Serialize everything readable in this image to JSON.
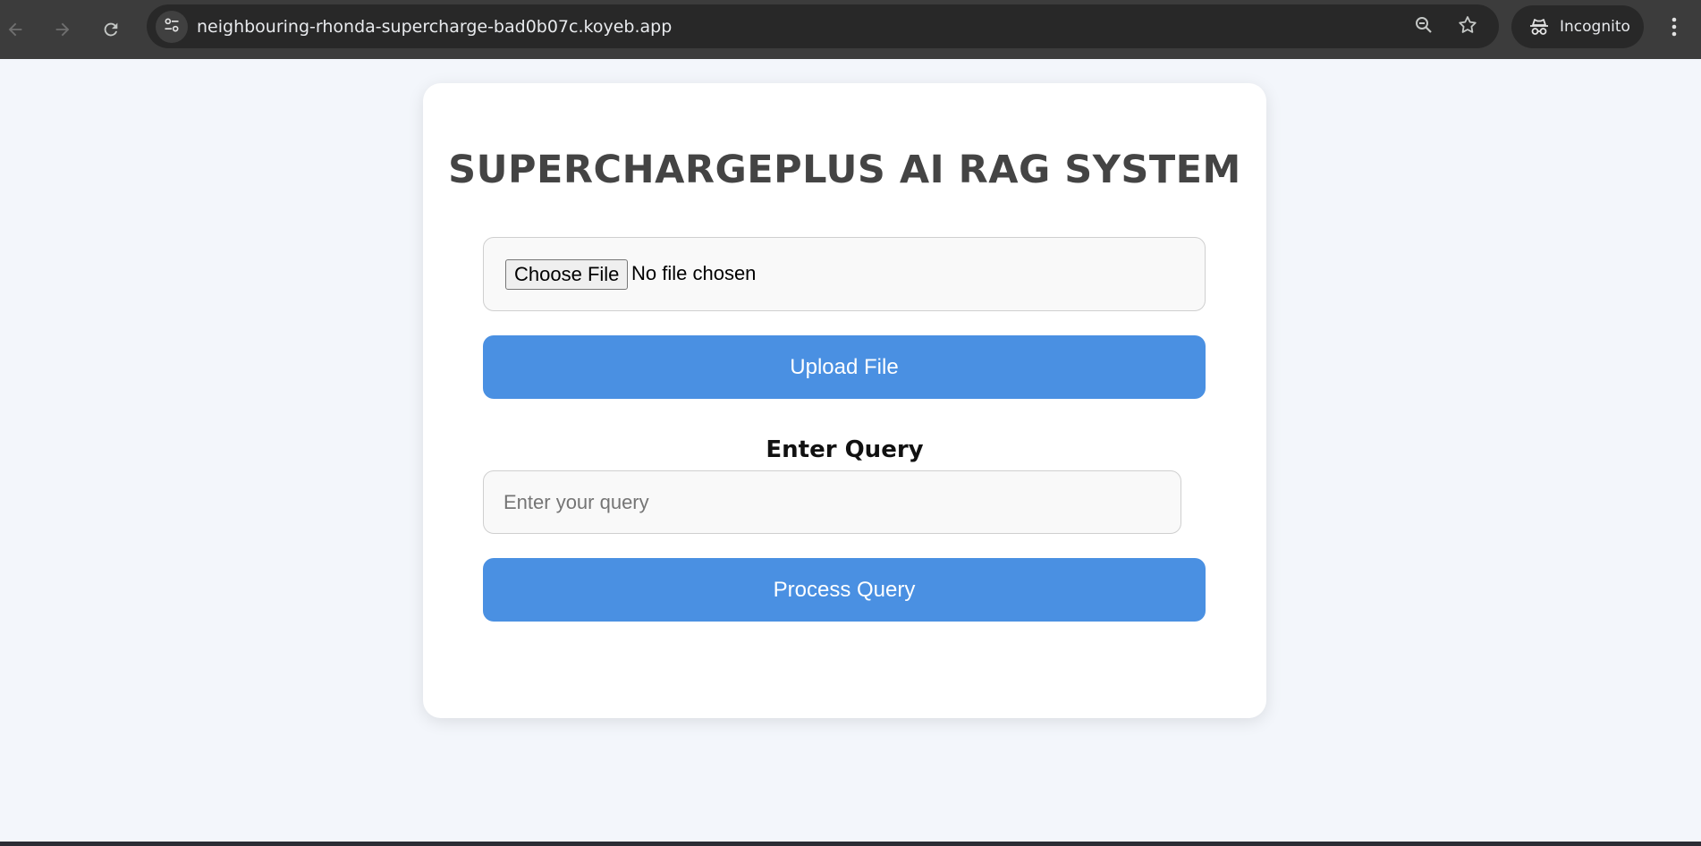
{
  "browser": {
    "url": "neighbouring-rhonda-supercharge-bad0b07c.koyeb.app",
    "incognito_label": "Incognito",
    "icons": {
      "back": "arrow-left-icon",
      "forward": "arrow-right-icon",
      "reload": "reload-icon",
      "site_info": "tune-icon",
      "zoom": "zoom-out-icon",
      "bookmark": "star-icon",
      "incognito": "incognito-icon",
      "menu": "kebab-menu-icon"
    }
  },
  "page": {
    "title": "SUPERCHARGEPLUS AI RAG SYSTEM",
    "file_input": {
      "button_label": "Choose File",
      "status": "No file chosen"
    },
    "upload_button": "Upload File",
    "query_label": "Enter Query",
    "query_input": {
      "value": "",
      "placeholder": "Enter your query"
    },
    "process_button": "Process Query"
  },
  "colors": {
    "accent": "#4a90e2",
    "background": "#f3f6fb",
    "title": "#444444"
  }
}
